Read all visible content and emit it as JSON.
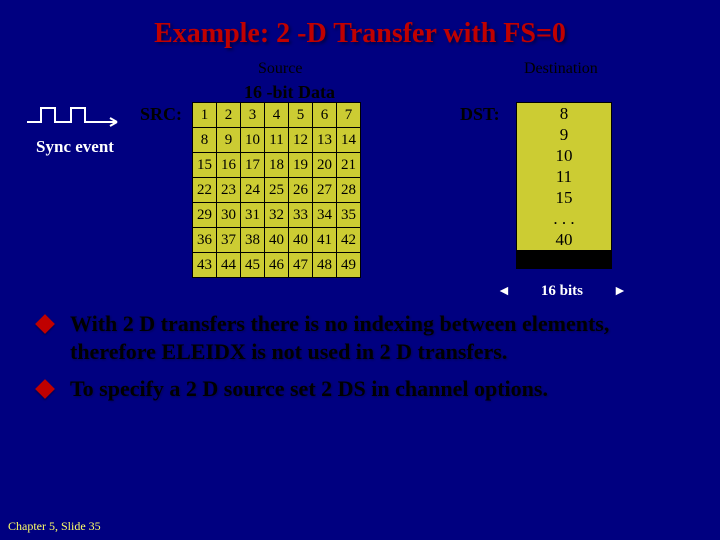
{
  "title": "Example: 2 -D Transfer with FS=0",
  "headers": {
    "source": "Source",
    "destination": "Destination",
    "subheader": "16 -bit Data"
  },
  "labels": {
    "src": "SRC:",
    "dst": "DST:",
    "sync": "Sync event",
    "width": "16 bits"
  },
  "source_grid": [
    [
      "1",
      "2",
      "3",
      "4",
      "5",
      "6",
      "7"
    ],
    [
      "8",
      "9",
      "10",
      "11",
      "12",
      "13",
      "14"
    ],
    [
      "15",
      "16",
      "17",
      "18",
      "19",
      "20",
      "21"
    ],
    [
      "22",
      "23",
      "24",
      "25",
      "26",
      "27",
      "28"
    ],
    [
      "29",
      "30",
      "31",
      "32",
      "33",
      "34",
      "35"
    ],
    [
      "36",
      "37",
      "38",
      "40",
      "40",
      "41",
      "42"
    ],
    [
      "43",
      "44",
      "45",
      "46",
      "47",
      "48",
      "49"
    ]
  ],
  "dest_column": [
    "8",
    "9",
    "10",
    "11",
    "15",
    ". . .",
    "40"
  ],
  "bullets": [
    "With 2 D transfers there is no indexing between elements, therefore ELEIDX is not used in 2 D transfers.",
    "To specify a 2 D source set 2 DS in channel options."
  ],
  "footer": "Chapter 5, Slide 35"
}
